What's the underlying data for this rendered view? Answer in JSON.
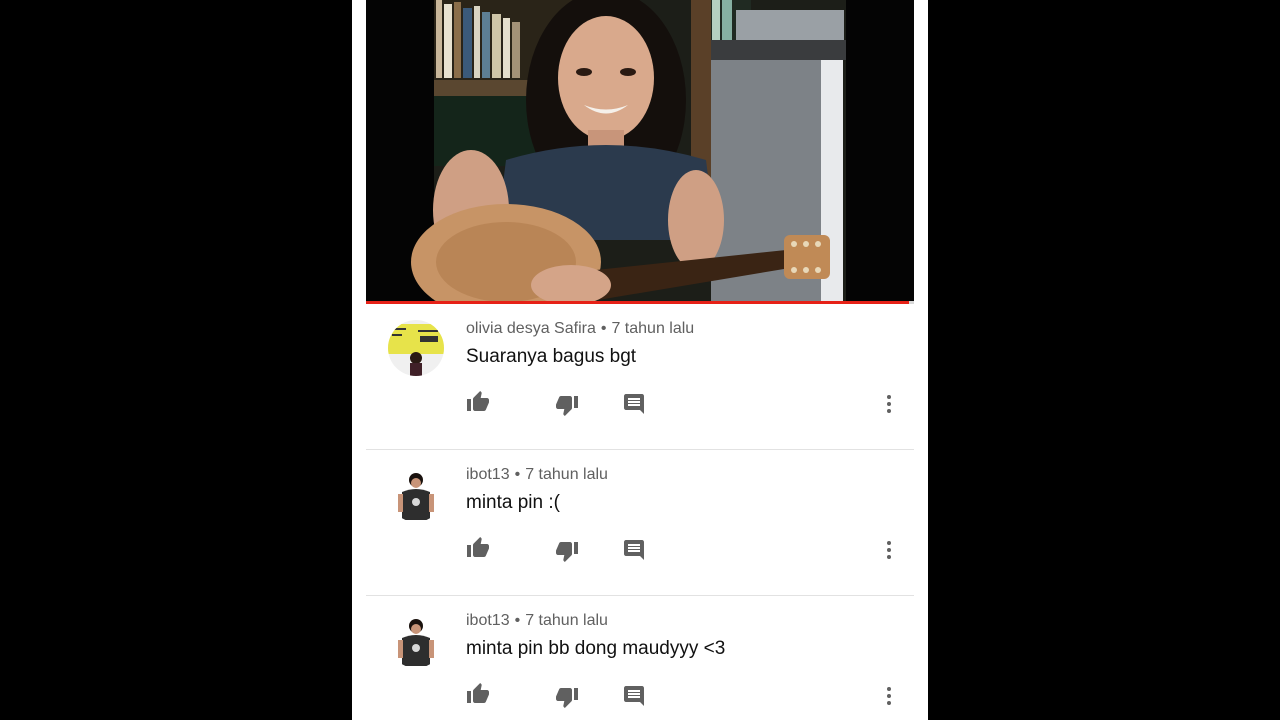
{
  "video": {
    "progress_fraction": 0.99
  },
  "comments": [
    {
      "author": "olivia desya Safira",
      "separator": "•",
      "time": "7 tahun lalu",
      "text": "Suaranya bagus bgt",
      "avatar_icon": "user-avatar-yellow-icon"
    },
    {
      "author": "ibot13",
      "separator": "•",
      "time": "7 tahun lalu",
      "text": "minta pin :(",
      "avatar_icon": "user-avatar-person-icon"
    },
    {
      "author": "ibot13",
      "separator": "•",
      "time": "7 tahun lalu",
      "text": "minta pin bb dong maudyyy <3",
      "avatar_icon": "user-avatar-person-icon"
    }
  ],
  "icons": {
    "like": "thumb-up-icon",
    "dislike": "thumb-down-icon",
    "reply": "comment-reply-icon",
    "more": "more-vert-icon"
  },
  "colors": {
    "progress": "#e62117",
    "meta_text": "#606060",
    "icon": "#606060"
  }
}
